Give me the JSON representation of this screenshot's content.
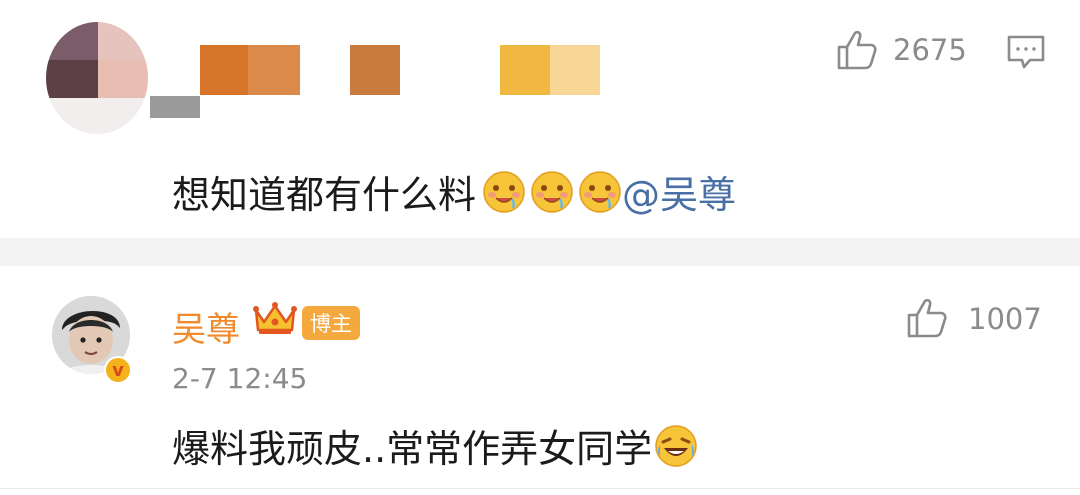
{
  "comment1": {
    "likes": "2675",
    "text": "想知道都有什么料",
    "emoji_count": 3,
    "emoji_name": "drooling-face-emoji",
    "mention": "@吴尊"
  },
  "comment2": {
    "username": "吴尊",
    "badge": "博主",
    "timestamp": "2-7 12:45",
    "likes": "1007",
    "text": "爆料我顽皮..常常作弄女同学",
    "emoji_name": "laughing-tears-emoji"
  },
  "icons": {
    "like": "thumbs-up-icon",
    "comment": "comment-icon",
    "crown": "crown-icon",
    "verified": "verified-badge-icon"
  },
  "colors": {
    "username": "#f08a2c",
    "mention": "#4a6fa5",
    "badge_bg": "#f5a83d",
    "meta_text": "#8b8b8b",
    "divider": "#f3f3f3"
  }
}
